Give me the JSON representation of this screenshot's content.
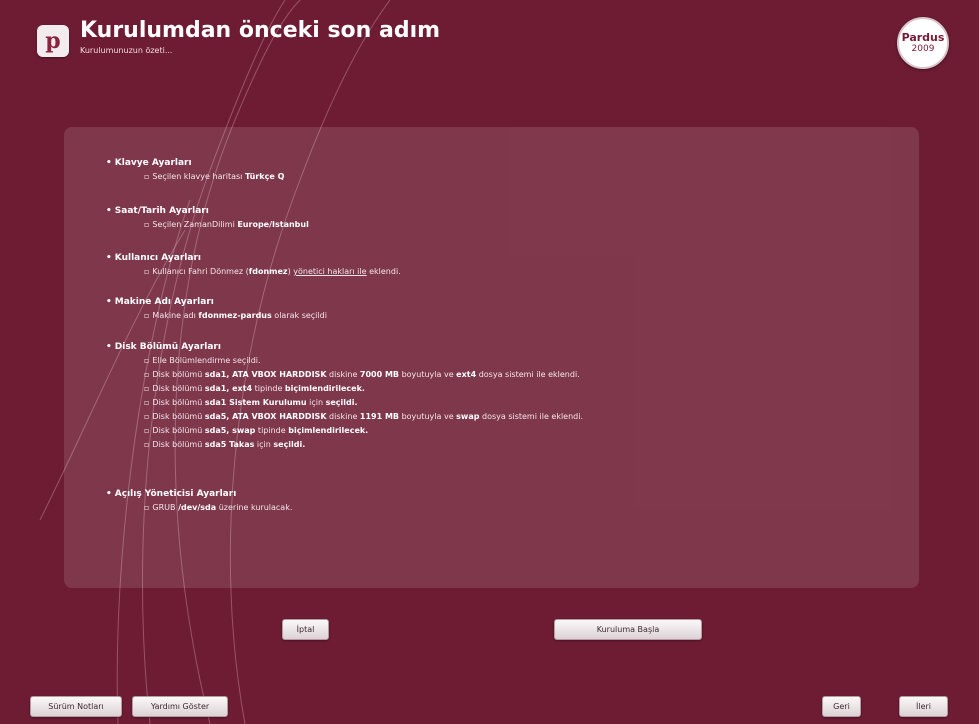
{
  "header": {
    "title": "Kurulumdan önceki son adım",
    "subtitle": "Kurulumunuzun özeti...",
    "logo_glyph": "p",
    "brand_name": "Pardus",
    "brand_year": "2009"
  },
  "summary": {
    "keyboard": {
      "title": "Klavye Ayarları",
      "line1": {
        "pre": "Seçilen klavye haritası ",
        "val": "Türkçe Q"
      }
    },
    "datetime": {
      "title": "Saat/Tarih Ayarları",
      "line1": {
        "pre": "Seçilen ZamanDilimi ",
        "val": "Europe/Istanbul"
      }
    },
    "user": {
      "title": "Kullanıcı Ayarları",
      "line1": {
        "pre": "Kullanıcı Fahri Dönmez (",
        "val": "fdonmez",
        "mid": ") ",
        "link": "yönetici hakları ile",
        "post": " eklendi."
      }
    },
    "machine": {
      "title": "Makine Adı Ayarları",
      "line1": {
        "pre": "Makine adı ",
        "val": "fdonmez-pardus",
        "post": " olarak seçildi"
      }
    },
    "disk": {
      "title": "Disk Bölümü Ayarları",
      "l1": {
        "pre": "Elle Bölümlendirme seçildi."
      },
      "l2": {
        "pre": "Disk bölümü ",
        "v1": "sda1, ATA VBOX HARDDISK",
        "m1": " diskine ",
        "v2": "7000 MB",
        "m2": " boyutuyla ve ",
        "v3": "ext4",
        "post": " dosya sistemi ile eklendi."
      },
      "l3": {
        "pre": "Disk bölümü ",
        "v1": "sda1, ext4",
        "m1": " tipinde ",
        "v2": "biçimlendirilecek."
      },
      "l4": {
        "pre": "Disk bölümü ",
        "v1": "sda1 Sistem Kurulumu",
        "m1": " için ",
        "v2": "seçildi."
      },
      "l5": {
        "pre": "Disk bölümü ",
        "v1": "sda5, ATA VBOX HARDDISK",
        "m1": " diskine ",
        "v2": "1191 MB",
        "m2": " boyutuyla ve ",
        "v3": "swap",
        "post": " dosya sistemi ile eklendi."
      },
      "l6": {
        "pre": "Disk bölümü ",
        "v1": "sda5, swap",
        "m1": " tipinde ",
        "v2": "biçimlendirilecek."
      },
      "l7": {
        "pre": "Disk bölümü ",
        "v1": "sda5 Takas",
        "m1": " için ",
        "v2": "seçildi."
      }
    },
    "bootloader": {
      "title": "Açılış Yöneticisi Ayarları",
      "line1": {
        "pre": "GRUB ",
        "val": "/dev/sda",
        "post": " üzerine kurulacak."
      }
    }
  },
  "buttons": {
    "cancel": "İptal",
    "start": "Kuruluma Başla",
    "release_notes": "Sürüm Notları",
    "show_help": "Yardımı Göster",
    "back": "Geri",
    "next": "İleri"
  },
  "colors": {
    "background": "#6e1c34",
    "panel": "#8a4d5e",
    "button_face": "#ece5e7"
  }
}
